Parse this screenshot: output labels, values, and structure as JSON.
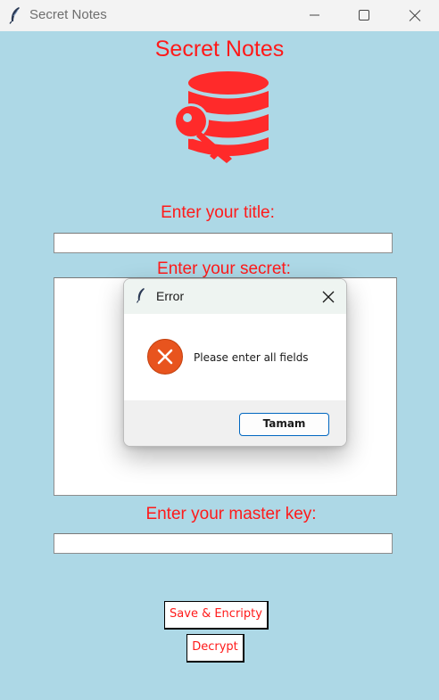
{
  "window": {
    "title": "Secret Notes",
    "icon": "feather-icon",
    "controls": [
      "minimize-icon",
      "maximize-icon",
      "close-icon"
    ]
  },
  "app": {
    "heading": "Secret Notes",
    "logo_icon": "database-key-icon",
    "title_label": "Enter your title:",
    "title_value": "",
    "secret_label": "Enter your secret:",
    "secret_value": "",
    "master_key_label": "Enter your master key:",
    "master_key_value": "",
    "save_button": "Save & Encripty",
    "decrypt_button": "Decrypt"
  },
  "dialog": {
    "title": "Error",
    "icon": "error-icon",
    "message": "Please enter all fields",
    "ok_button": "Tamam"
  },
  "colors": {
    "background": "#add8e6",
    "accent": "#ff1a1a",
    "error_icon": "#e8541e",
    "dialog_button_border": "#0067c0"
  }
}
